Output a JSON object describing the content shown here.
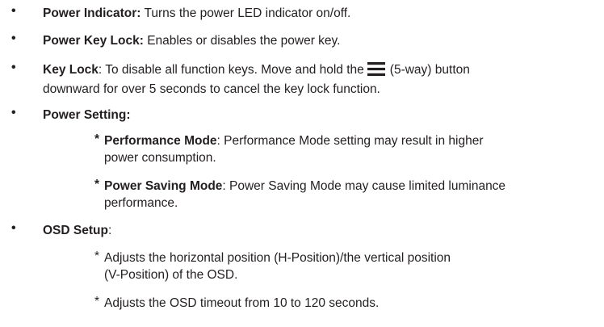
{
  "items": [
    {
      "bullet": "•",
      "label": "Power Indicator:",
      "text": " Turns the power LED indicator on/off."
    },
    {
      "bullet": "•",
      "label": "Power Key Lock:",
      "text": " Enables or disables the power key."
    },
    {
      "bullet": "•",
      "label": "Key Lock",
      "text_before_icon": ": To disable all function keys. Move and hold the",
      "icon": "menu-icon",
      "text_after_icon": "(5-way) button",
      "line2": "downward for over 5 seconds to cancel the key lock function."
    },
    {
      "bullet": "•",
      "label": "Power Setting:"
    },
    {
      "bullet": "*",
      "label": "Performance Mode",
      "text": ": Performance Mode setting may result in higher",
      "line2": "power consumption."
    },
    {
      "bullet": "*",
      "label": "Power Saving Mode",
      "text": ": Power Saving Mode may cause limited luminance",
      "line2": "performance."
    },
    {
      "bullet": "•",
      "label": "OSD Setup",
      "text": ":"
    },
    {
      "bullet": "*",
      "text": "Adjusts the horizontal position (H-Position)/the vertical position",
      "line2": "(V-Position) of the OSD."
    },
    {
      "bullet": "*",
      "text": "Adjusts the OSD timeout from 10 to 120 seconds."
    }
  ]
}
